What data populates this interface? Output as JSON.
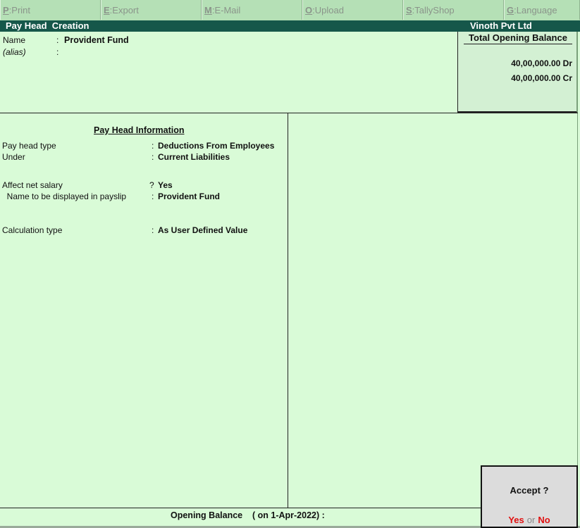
{
  "toolbar": {
    "buttons": [
      {
        "key": "P",
        "label": "Print"
      },
      {
        "key": "E",
        "label": "Export"
      },
      {
        "key": "M",
        "label": "E-Mail"
      },
      {
        "key": "O",
        "label": "Upload"
      },
      {
        "key": "S",
        "label": "TallyShop"
      },
      {
        "key": "G",
        "label": "Language"
      }
    ]
  },
  "title": {
    "screen": "Pay Head  Creation",
    "company": "Vinoth Pvt Ltd"
  },
  "header": {
    "name_label": "Name",
    "name_sep": ":",
    "name_value": "Provident Fund",
    "alias_label": "(alias)",
    "alias_sep": ":",
    "alias_value": ""
  },
  "total_opening_balance": {
    "title": "Total Opening Balance",
    "debit": "40,00,000.00 Dr",
    "credit": "40,00,000.00 Cr"
  },
  "pay_head_info": {
    "title": "Pay Head Information",
    "fields": [
      {
        "label": "Pay head type",
        "sep": ":",
        "value": "Deductions From Employees"
      },
      {
        "label": "Under",
        "sep": ":",
        "value": "Current Liabilities"
      },
      {
        "label": "Affect net salary",
        "sep": "?",
        "value": "Yes"
      },
      {
        "label": "  Name to be displayed in payslip",
        "sep": ":",
        "value": "Provident Fund"
      },
      {
        "label": "Calculation type",
        "sep": ":",
        "value": "As User Defined Value"
      }
    ]
  },
  "footer": {
    "opening_balance": "Opening Balance    ( on 1-Apr-2022) :"
  },
  "accept_dialog": {
    "question": "Accept ?",
    "yes": "Yes",
    "or": "or",
    "no": "No"
  }
}
